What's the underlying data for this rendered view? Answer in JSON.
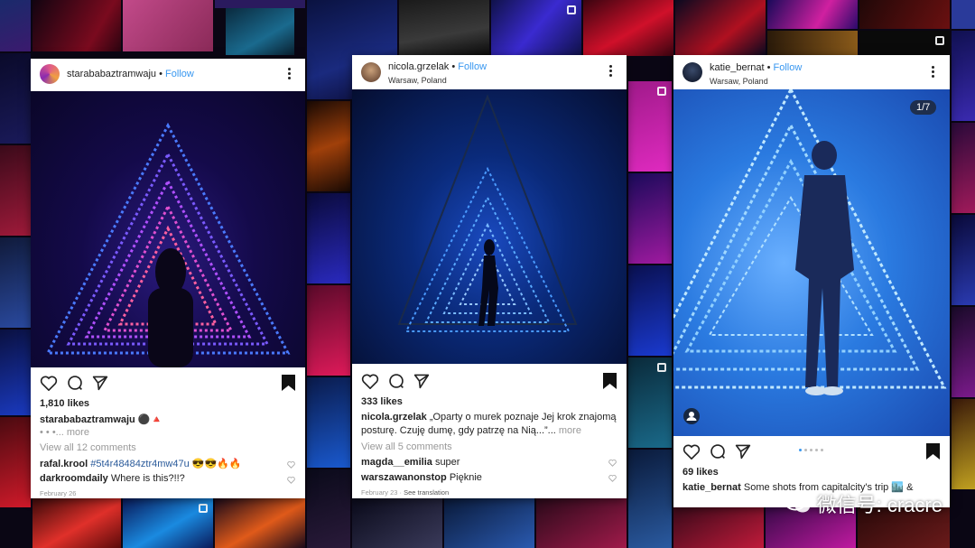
{
  "posts": [
    {
      "username": "starababaztramwaju",
      "follow": "Follow",
      "location": "",
      "likes": "1,810 likes",
      "caption_user": "starababaztramwaju",
      "caption_text": "⚫🔺",
      "caption_more": "• • •... more",
      "view_comments": "View all 12 comments",
      "comments": [
        {
          "user": "rafal.krool",
          "text": "#5t4r48484ztr4mw47u 😎😎🔥🔥"
        },
        {
          "user": "darkroomdaily",
          "text": "Where is this?!!?"
        }
      ],
      "date": "February 26",
      "see_translation": ""
    },
    {
      "username": "nicola.grzelak",
      "follow": "Follow",
      "location": "Warsaw, Poland",
      "likes": "333 likes",
      "caption_user": "nicola.grzelak",
      "caption_text": "„Oparty o murek poznaje Jej krok znajomą",
      "caption_text2": "posturę. Czuję dumę, gdy patrzę na Nią...”...",
      "caption_more": "more",
      "view_comments": "View all 5 comments",
      "comments": [
        {
          "user": "magda__emilia",
          "text": "super"
        },
        {
          "user": "warszawanonstop",
          "text": "Pięknie"
        }
      ],
      "date": "February 23",
      "see_translation": "See translation"
    },
    {
      "username": "katie_bernat",
      "follow": "Follow",
      "location": "Warsaw, Poland",
      "counter": "1/7",
      "likes": "69 likes",
      "caption_user": "katie_bernat",
      "caption_text": "Some shots from capitalcity's trip 🏙️ &"
    }
  ],
  "separator": "•",
  "watermark": "微信号: cracre",
  "colors": {
    "follow": "#3897f0",
    "bg": "#0a0614"
  }
}
